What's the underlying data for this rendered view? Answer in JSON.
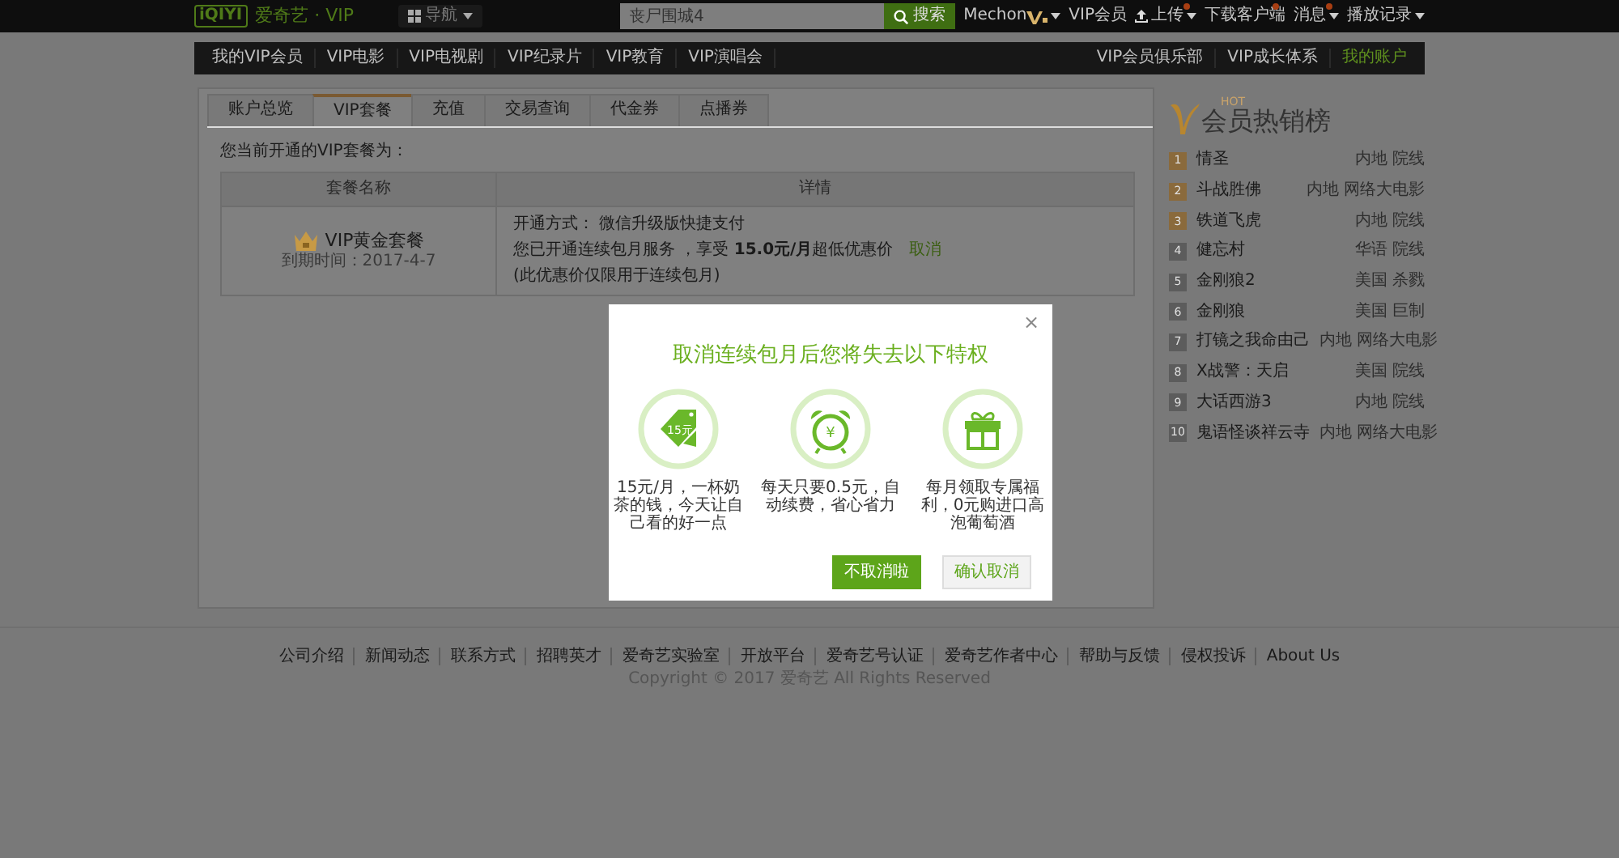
{
  "top_bar": {
    "logo_mark": "iQIYI",
    "logo_text": "爱奇艺 · VIP",
    "nav_menu": "导航",
    "search": {
      "placeholder": "丧尸围城4",
      "button": "搜索"
    },
    "user": "Mechon",
    "links": [
      {
        "kind": "plain",
        "label": "VIP会员",
        "notification": false,
        "dropdown": false
      },
      {
        "kind": "upload",
        "label": "上传",
        "notification": true,
        "dropdown": true
      },
      {
        "kind": "plain",
        "label": "下载客户端",
        "notification": true,
        "dropdown": false
      },
      {
        "kind": "plain",
        "label": "消息",
        "notification": true,
        "dropdown": true
      },
      {
        "kind": "plain",
        "label": "播放记录",
        "notification": false,
        "dropdown": true
      }
    ]
  },
  "main_nav": {
    "left_items": [
      {
        "label": "我的VIP会员",
        "selected": false
      },
      {
        "label": "VIP电影",
        "selected": false
      },
      {
        "label": "VIP电视剧",
        "selected": false
      },
      {
        "label": "VIP纪录片",
        "selected": false
      },
      {
        "label": "VIP教育",
        "selected": false
      },
      {
        "label": "VIP演唱会",
        "selected": false
      }
    ],
    "right_items": [
      {
        "label": "VIP会员俱乐部",
        "selected": false
      },
      {
        "label": "VIP成长体系",
        "selected": false
      },
      {
        "label": "我的账户",
        "selected": true
      }
    ]
  },
  "account_tabs": [
    {
      "label": "账户总览",
      "selected": false
    },
    {
      "label": "VIP套餐",
      "selected": true
    },
    {
      "label": "充值",
      "selected": false
    },
    {
      "label": "交易查询",
      "selected": false
    },
    {
      "label": "代金券",
      "selected": false
    },
    {
      "label": "点播券",
      "selected": false
    }
  ],
  "intro": "您当前开通的VIP套餐为：",
  "package_table": {
    "columns": [
      "套餐名称",
      "详情"
    ],
    "rows": [
      {
        "name": "VIP黄金套餐",
        "expiry": "到期时间：2017-4-7",
        "method": "开通方式： 微信升级版快捷支付",
        "service": "您已开通连续包月服务 ，享受 **15.0元/月**超低优惠价",
        "cancel_link": "取消",
        "note": "(此优惠价仅限用于连续包月)"
      }
    ]
  },
  "ranking": {
    "hot": "HOT",
    "title": "会员热销榜",
    "items": [
      {
        "rank": "1",
        "title": "情圣",
        "tags": "内地 院线",
        "color": "#8a6a3c"
      },
      {
        "rank": "2",
        "title": "斗战胜佛",
        "tags": "内地 网络大电影",
        "color": "#8a6a3c"
      },
      {
        "rank": "3",
        "title": "铁道飞虎",
        "tags": "内地 院线",
        "color": "#8a6a3c"
      },
      {
        "rank": "4",
        "title": "健忘村",
        "tags": "华语 院线",
        "color": "#5c5c5c"
      },
      {
        "rank": "5",
        "title": "金刚狼2",
        "tags": "美国 杀戮",
        "color": "#5c5c5c"
      },
      {
        "rank": "6",
        "title": "金刚狼",
        "tags": "美国 巨制",
        "color": "#5c5c5c"
      },
      {
        "rank": "7",
        "title": "打镜之我命由己",
        "tags": "内地 网络大电影",
        "color": "#5c5c5c"
      },
      {
        "rank": "8",
        "title": "X战警：天启",
        "tags": "美国 院线",
        "color": "#5c5c5c"
      },
      {
        "rank": "9",
        "title": "大话西游3",
        "tags": "内地 院线",
        "color": "#5c5c5c"
      },
      {
        "rank": "10",
        "title": "鬼语怪谈祥云寺",
        "tags": "内地 网络大电影",
        "color": "#5c5c5c"
      }
    ]
  },
  "footer": {
    "links": [
      "公司介绍",
      "新闻动态",
      "联系方式",
      "招聘英才",
      "爱奇艺实验室",
      "开放平台",
      "爱奇艺号认证",
      "爱奇艺作者中心",
      "帮助与反馈",
      "侵权投诉",
      "About Us"
    ],
    "copyright": "Copyright © 2017 爱奇艺 All Rights Reserved"
  },
  "modal": {
    "close": "×",
    "title": "取消连续包月后您将失去以下特权",
    "features": [
      {
        "kind": "tag",
        "icon_text": "15元",
        "text": "15元/月，一杯奶茶的钱，今天让自己看的好一点"
      },
      {
        "kind": "clock",
        "icon_text": "¥",
        "text": "每天只要0.5元，自动续费，省心省力"
      },
      {
        "kind": "gift",
        "text": "每月领取专属福利，0元购进口高泡葡萄酒"
      }
    ],
    "buttons": [
      {
        "kind": "primary",
        "label": "不取消啦"
      },
      {
        "kind": "secondary",
        "label": "确认取消"
      }
    ]
  }
}
